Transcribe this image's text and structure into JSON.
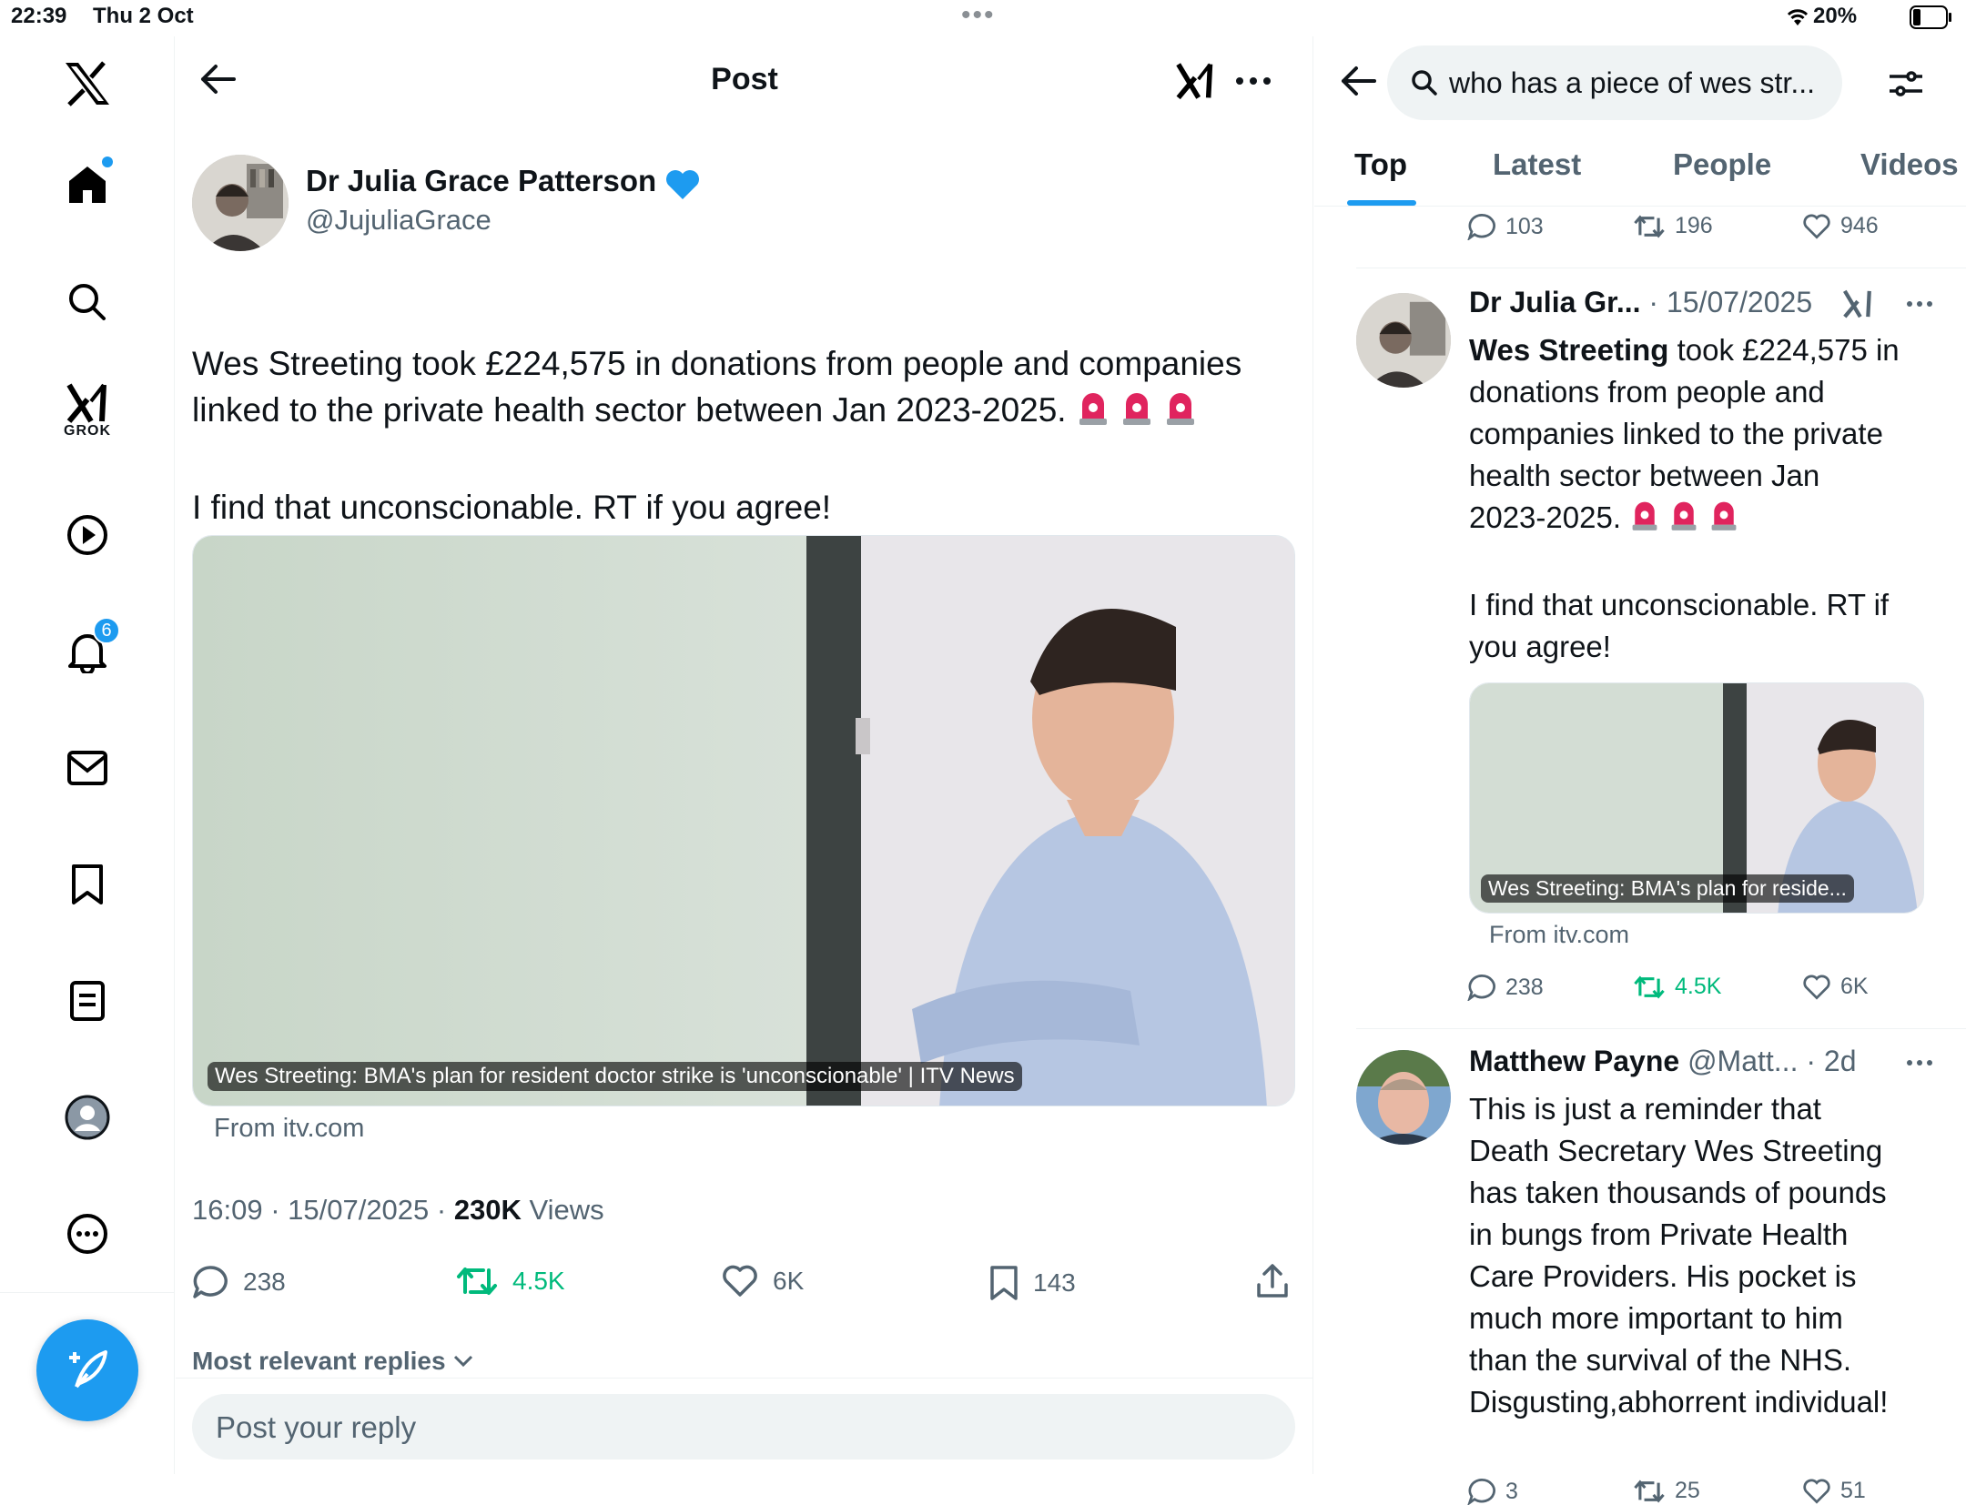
{
  "status_bar": {
    "time": "22:39",
    "date": "Thu 2 Oct",
    "battery": "20%"
  },
  "sidebar": {
    "grok_label": "GROK",
    "notifications_badge": "6"
  },
  "post": {
    "header_title": "Post",
    "author_name": "Dr Julia Grace Patterson",
    "author_handle": "@JujuliaGrace",
    "text_line1": "Wes Streeting took £224,575 in donations from people and companies",
    "text_line2": "linked to the private health sector between Jan 2023-2025.",
    "text_line3": "I find that unconscionable. RT if you agree!",
    "card_caption": "Wes Streeting: BMA's plan for resident doctor strike is 'unconscionable' | ITV News",
    "card_source": "From itv.com",
    "timestamp": "16:09 · 15/07/2025 · ",
    "views_count": "230K",
    "views_label": " Views",
    "replies": "238",
    "reposts": "4.5K",
    "likes": "6K",
    "bookmarks": "143",
    "relevant_replies": "Most relevant replies",
    "reply_placeholder": "Post your reply"
  },
  "search": {
    "query": "who has a piece of wes str...",
    "tabs": [
      "Top",
      "Latest",
      "People",
      "Videos"
    ],
    "prev_stats": {
      "replies": "103",
      "reposts": "196",
      "likes": "946"
    },
    "results": [
      {
        "name": "Dr Julia Gr...",
        "date": "· 15/07/2025",
        "text_bold": "Wes Streeting",
        "text_lines": [
          " took £224,575 in",
          "donations from people and",
          "companies linked to the private",
          "health sector between Jan",
          "2023-2025."
        ],
        "text_line_b": "I find that unconscionable. RT if",
        "text_line_c": "you agree!",
        "card_caption": "Wes Streeting: BMA's plan for reside...",
        "card_source": "From itv.com",
        "replies": "238",
        "reposts": "4.5K",
        "likes": "6K"
      },
      {
        "name": "Matthew Payne",
        "handle": "@Matt...",
        "date": "· 2d",
        "lines": [
          "This is just a reminder that",
          "Death Secretary Wes Streeting",
          "has taken thousands of pounds",
          "in bungs from Private Health",
          "Care Providers. His pocket is",
          "much more important to him",
          "than the survival of the NHS.",
          "Disgusting,abhorrent individual!"
        ],
        "replies": "3",
        "reposts": "25",
        "likes": "51"
      }
    ]
  },
  "colors": {
    "accent": "#1d9bf0",
    "repost_green": "#00ba7c",
    "muted": "#536471"
  }
}
